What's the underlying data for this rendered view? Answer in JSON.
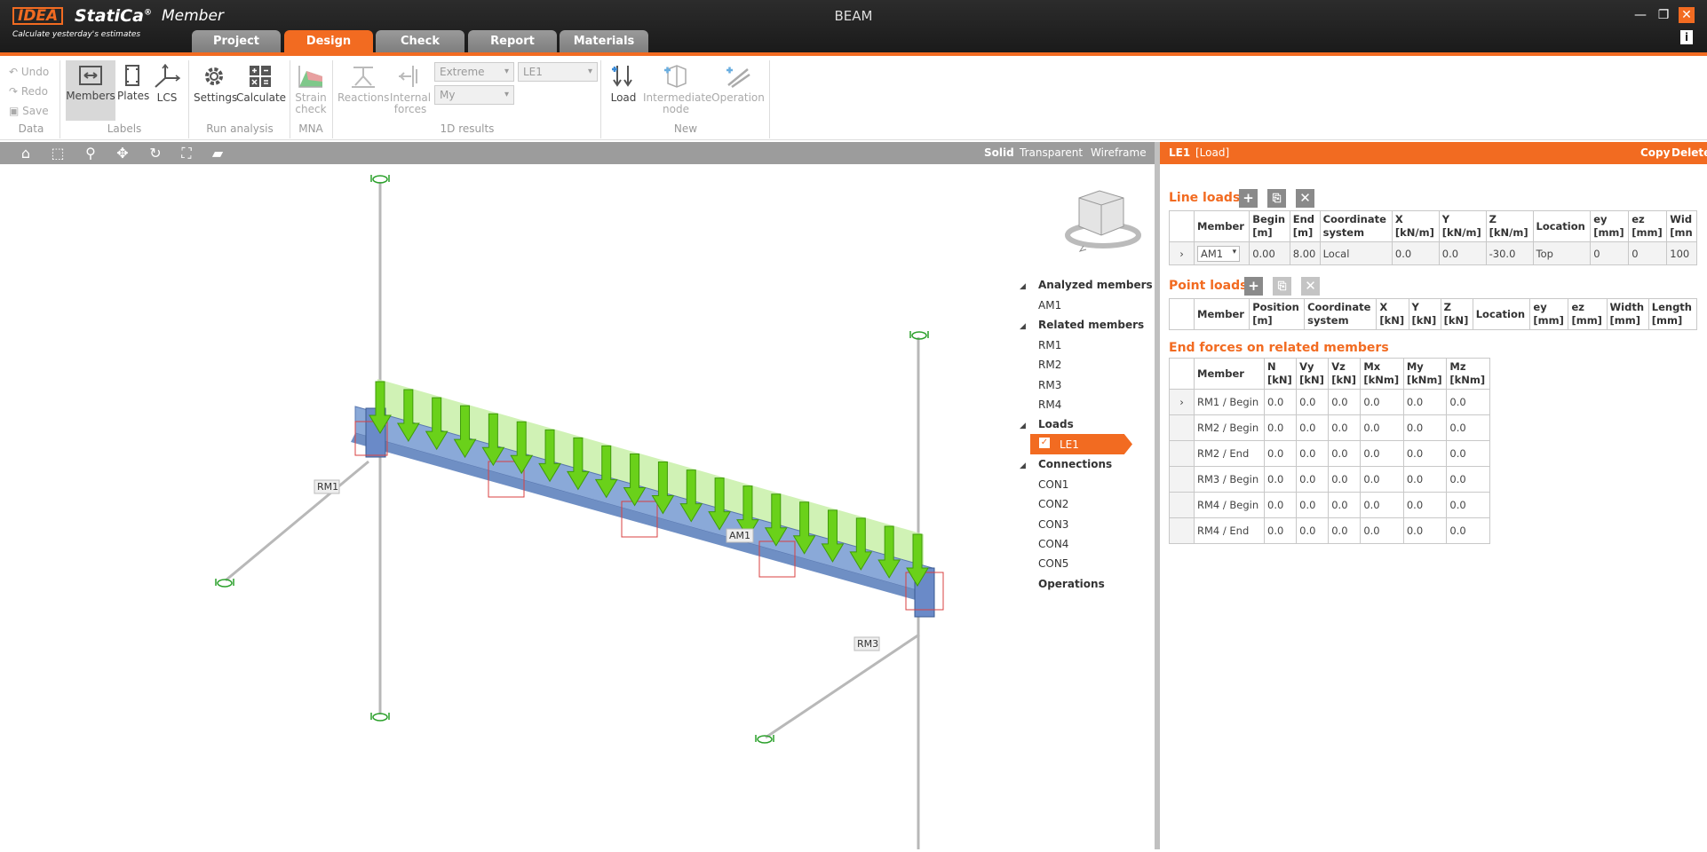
{
  "app": {
    "logo": "IDEA",
    "brand": "StatiCa",
    "brand_mark": "®",
    "module": "Member",
    "tagline": "Calculate yesterday's estimates",
    "window_title": "BEAM",
    "accent_color": "#f26b21"
  },
  "window_buttons": [
    "—",
    "❐",
    "✕",
    "i"
  ],
  "tabs": [
    "Project",
    "Design",
    "Check",
    "Report",
    "Materials"
  ],
  "active_tab": "Design",
  "ribbon": {
    "data": {
      "undo": "Undo",
      "redo": "Redo",
      "save": "Save",
      "group": "Data"
    },
    "labels": {
      "members": "Members",
      "plates": "Plates",
      "lcs": "LCS",
      "group": "Labels"
    },
    "run": {
      "settings": "Settings",
      "calculate": "Calculate",
      "group": "Run analysis"
    },
    "mna": {
      "strain": "Strain",
      "check": "check",
      "group": "MNA"
    },
    "results": {
      "reactions": "Reactions",
      "internal": "Internal",
      "forces": "forces",
      "extreme": "Extreme",
      "le": "LE1",
      "my": "My",
      "group": "1D results"
    },
    "new": {
      "load": "Load",
      "intermediate": "Intermediate",
      "node": "node",
      "operation": "Operation",
      "group": "New"
    }
  },
  "viewport": {
    "modes": [
      "Solid",
      "Transparent",
      "Wireframe"
    ],
    "active_mode": "Solid",
    "labels": {
      "rm1": "RM1",
      "rm3": "RM3",
      "am1": "AM1"
    }
  },
  "tree": {
    "analyzed": "Analyzed members",
    "am1": "AM1",
    "related": "Related members",
    "rm": [
      "RM1",
      "RM2",
      "RM3",
      "RM4"
    ],
    "loads": "Loads",
    "le1": "LE1",
    "connections": "Connections",
    "con": [
      "CON1",
      "CON2",
      "CON3",
      "CON4",
      "CON5"
    ],
    "operations": "Operations"
  },
  "panel": {
    "name": "LE1",
    "type": "[Load]",
    "copy": "Copy",
    "delete": "Delete",
    "line_loads": {
      "title": "Line loads",
      "headers": [
        [
          "Member",
          ""
        ],
        [
          "Begin",
          "[m]"
        ],
        [
          "End",
          "[m]"
        ],
        [
          "Coordinate",
          "system"
        ],
        [
          "X",
          "[kN/m]"
        ],
        [
          "Y",
          "[kN/m]"
        ],
        [
          "Z",
          "[kN/m]"
        ],
        [
          "Location",
          ""
        ],
        [
          "ey",
          "[mm]"
        ],
        [
          "ez",
          "[mm]"
        ],
        [
          "Wid",
          "[mn"
        ]
      ],
      "rows": [
        [
          "AM1",
          "0.00",
          "8.00",
          "Local",
          "0.0",
          "0.0",
          "-30.0",
          "Top",
          "0",
          "0",
          "100"
        ]
      ]
    },
    "point_loads": {
      "title": "Point loads",
      "headers": [
        [
          "Member",
          ""
        ],
        [
          "Position",
          "[m]"
        ],
        [
          "Coordinate",
          "system"
        ],
        [
          "X",
          "[kN]"
        ],
        [
          "Y",
          "[kN]"
        ],
        [
          "Z",
          "[kN]"
        ],
        [
          "Location",
          ""
        ],
        [
          "ey",
          "[mm]"
        ],
        [
          "ez",
          "[mm]"
        ],
        [
          "Width",
          "[mm]"
        ],
        [
          "Length",
          "[mm]"
        ]
      ]
    },
    "end_forces": {
      "title": "End forces on related members",
      "headers": [
        [
          "Member",
          ""
        ],
        [
          "N",
          "[kN]"
        ],
        [
          "Vy",
          "[kN]"
        ],
        [
          "Vz",
          "[kN]"
        ],
        [
          "Mx",
          "[kNm]"
        ],
        [
          "My",
          "[kNm]"
        ],
        [
          "Mz",
          "[kNm]"
        ]
      ],
      "rows": [
        [
          "RM1 / Begin",
          "0.0",
          "0.0",
          "0.0",
          "0.0",
          "0.0",
          "0.0"
        ],
        [
          "RM2 / Begin",
          "0.0",
          "0.0",
          "0.0",
          "0.0",
          "0.0",
          "0.0"
        ],
        [
          "RM2 / End",
          "0.0",
          "0.0",
          "0.0",
          "0.0",
          "0.0",
          "0.0"
        ],
        [
          "RM3 / Begin",
          "0.0",
          "0.0",
          "0.0",
          "0.0",
          "0.0",
          "0.0"
        ],
        [
          "RM4 / Begin",
          "0.0",
          "0.0",
          "0.0",
          "0.0",
          "0.0",
          "0.0"
        ],
        [
          "RM4 / End",
          "0.0",
          "0.0",
          "0.0",
          "0.0",
          "0.0",
          "0.0"
        ]
      ]
    }
  }
}
